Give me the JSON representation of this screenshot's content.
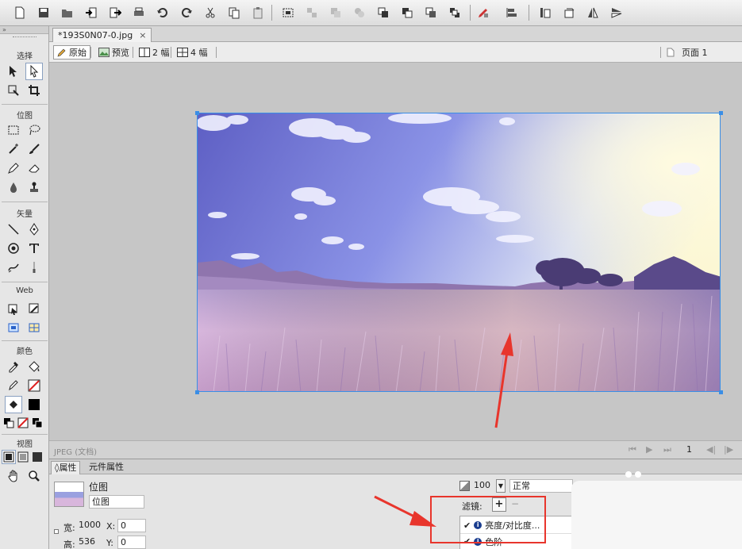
{
  "toolbar": {
    "icons": [
      "new-icon",
      "save-icon",
      "open-icon",
      "import-icon",
      "export-icon",
      "print-icon",
      "undo-icon",
      "redo-icon",
      "cut-icon",
      "copy-icon",
      "paste-icon",
      "group-icon",
      "ungroup-icon",
      "join-icon",
      "split-icon",
      "bring-front-icon",
      "bring-forward-icon",
      "send-backward-icon",
      "send-back-icon",
      "edit-icon",
      "align-icon",
      "rotate-left-icon",
      "rotate-right-icon",
      "flip-horizontal-icon",
      "flip-vertical-icon"
    ]
  },
  "tools": {
    "header": "»",
    "sections": {
      "select": "选择",
      "bitmap": "位图",
      "vector": "矢量",
      "web": "Web",
      "color": "颜色",
      "view": "视图"
    }
  },
  "document": {
    "tab_title": "*193S0N07-0.jpg",
    "tab_close": "×",
    "views": {
      "original": "原始",
      "preview": "预览",
      "two_up": "2 幅",
      "four_up": "4 幅"
    },
    "page_label": "页面 1",
    "status": "JPEG (文档)",
    "page_number": "1"
  },
  "properties": {
    "tabs": {
      "properties": "属性",
      "symbol": "元件属性"
    },
    "object_type": "位图",
    "object_name": "位图",
    "width_label": "宽:",
    "width_value": "1000",
    "height_label": "高:",
    "height_value": "536",
    "x_label": "X:",
    "x_value": "0",
    "y_label": "Y:",
    "y_value": "0",
    "opacity_value": "100",
    "blend_mode": "正常",
    "filters_label": "滤镜:",
    "filters": [
      {
        "name": "亮度/对比度..."
      },
      {
        "name": "色阶"
      }
    ]
  },
  "colors": {
    "accent_blue": "#3a8ee6",
    "annotation_red": "#e8352c"
  }
}
